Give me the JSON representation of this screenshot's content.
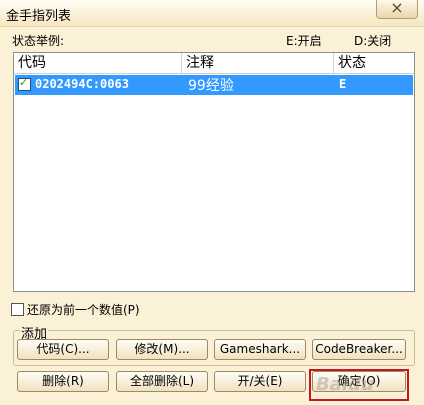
{
  "window": {
    "title": "金手指列表",
    "close_glyph": "×"
  },
  "legend": {
    "label": "状态举例:",
    "enabled": "E:开启",
    "disabled": "D:关闭"
  },
  "list": {
    "columns": [
      "代码",
      "注释",
      "状态"
    ],
    "rows": [
      {
        "checked": true,
        "code": "0202494C:0063",
        "comment": "99经验",
        "status": "E"
      }
    ]
  },
  "restore_checkbox": {
    "label": "还原为前一个数值(P)",
    "checked": false
  },
  "add_group": {
    "label": "添加",
    "buttons": [
      "代码(C)...",
      "修改(M)...",
      "Gameshark...",
      "CodeBreaker..."
    ]
  },
  "bottom_buttons": [
    "删除(R)",
    "全部删除(L)",
    "开/关(E)",
    "确定(O)"
  ],
  "watermark": "Baidu",
  "colors": {
    "selection": "#3399ff",
    "highlight_box": "#c8171c"
  }
}
